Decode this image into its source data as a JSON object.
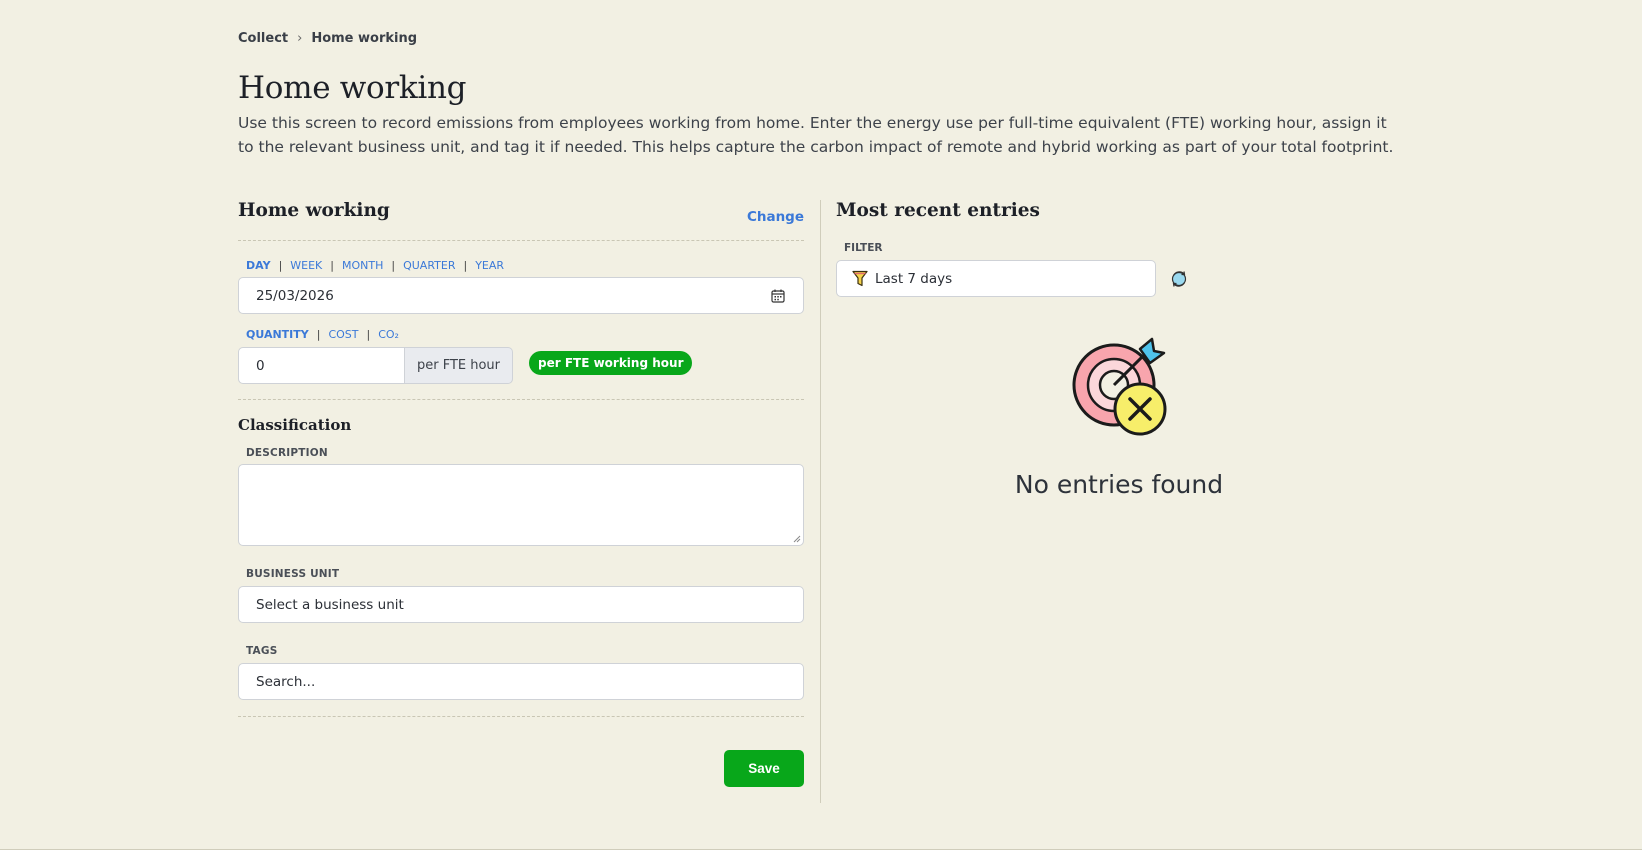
{
  "breadcrumb": {
    "items": [
      "Collect",
      "Home working"
    ],
    "separator": "›"
  },
  "page": {
    "title": "Home working",
    "description": "Use this screen to record emissions from employees working from home. Enter the energy use per full-time equivalent (FTE) working hour, assign it to the relevant business unit, and tag it if needed. This helps capture the carbon impact of remote and hybrid working as part of your total footprint."
  },
  "form": {
    "title": "Home working",
    "change_label": "Change",
    "period_tabs": [
      "DAY",
      "WEEK",
      "MONTH",
      "QUARTER",
      "YEAR"
    ],
    "period_active": "DAY",
    "date_value": "25/03/2026",
    "quantity_tabs": [
      "QUANTITY",
      "COST",
      "CO₂"
    ],
    "quantity_active": "QUANTITY",
    "quantity_value": "0",
    "quantity_unit": "per FTE hour",
    "unit_badge": "per FTE working hour",
    "classification_title": "Classification",
    "description_label": "DESCRIPTION",
    "description_value": "",
    "business_unit_label": "BUSINESS UNIT",
    "business_unit_value": "Select a business unit",
    "tags_label": "TAGS",
    "tags_placeholder": "Search...",
    "save_label": "Save"
  },
  "recent": {
    "title": "Most recent entries",
    "filter_label": "FILTER",
    "filter_value": "Last 7 days",
    "empty_text": "No entries found"
  },
  "colors": {
    "background": "#f2f0e3",
    "accent_link": "#3b79d8",
    "primary_green": "#08a71a"
  },
  "icons": [
    "chevron-right-icon",
    "calendar-icon",
    "funnel-icon",
    "refresh-icon",
    "target-miss-illustration"
  ]
}
